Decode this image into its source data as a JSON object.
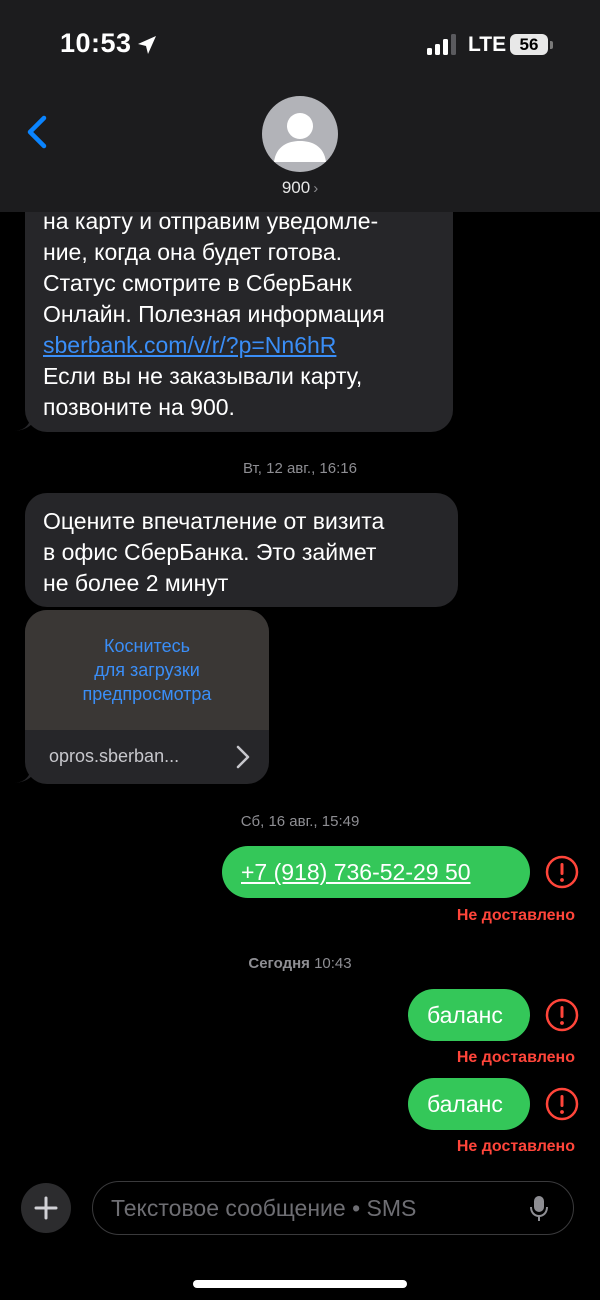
{
  "status_bar": {
    "time": "10:53",
    "network": "LTE",
    "battery": "56",
    "icons": [
      "location-icon",
      "signal-icon",
      "battery-icon"
    ]
  },
  "header": {
    "contact_name": "900",
    "chevron": "›",
    "icons": [
      "back-chevron-icon",
      "person-avatar-icon"
    ]
  },
  "messages": {
    "first_text": "на карту и отправим уведомле-\nние, когда она будет готова.\nСтатус смотрите в СберБанк\nОнлайн. Полезная информация",
    "first_link": "sberbank.com/v/r/?p=Nn6hR",
    "first_tail": "\nЕсли вы не заказывали карту,\nпозвоните на 900.",
    "timestamp_1_day": "Вт, 12 авг.,",
    "timestamp_1_time": "16:16",
    "second_text": "Оцените впечатление от визита\nв офис СберБанка. Это займет\nне более 2 минут",
    "preview_hint": "Коснитесь\nдля загрузки\nпредпросмотра",
    "preview_domain": "opros.sberban...",
    "timestamp_2_day": "Сб, 16 авг.,",
    "timestamp_2_time": "15:49",
    "outgoing_phone": "+7 (918) 736-52-29 50",
    "not_delivered": "Не доставлено",
    "timestamp_3_day": "Сегодня",
    "timestamp_3_time": "10:43",
    "outgoing_1": "баланс",
    "outgoing_2": "баланс"
  },
  "colors": {
    "incoming_bubble": "#262629",
    "outgoing_bubble": "#34c759",
    "error_red": "#ff453a",
    "link_blue": "#3a8ef7"
  },
  "composer": {
    "placeholder": "Текстовое сообщение • SMS",
    "icons": [
      "plus-icon",
      "microphone-icon"
    ]
  }
}
